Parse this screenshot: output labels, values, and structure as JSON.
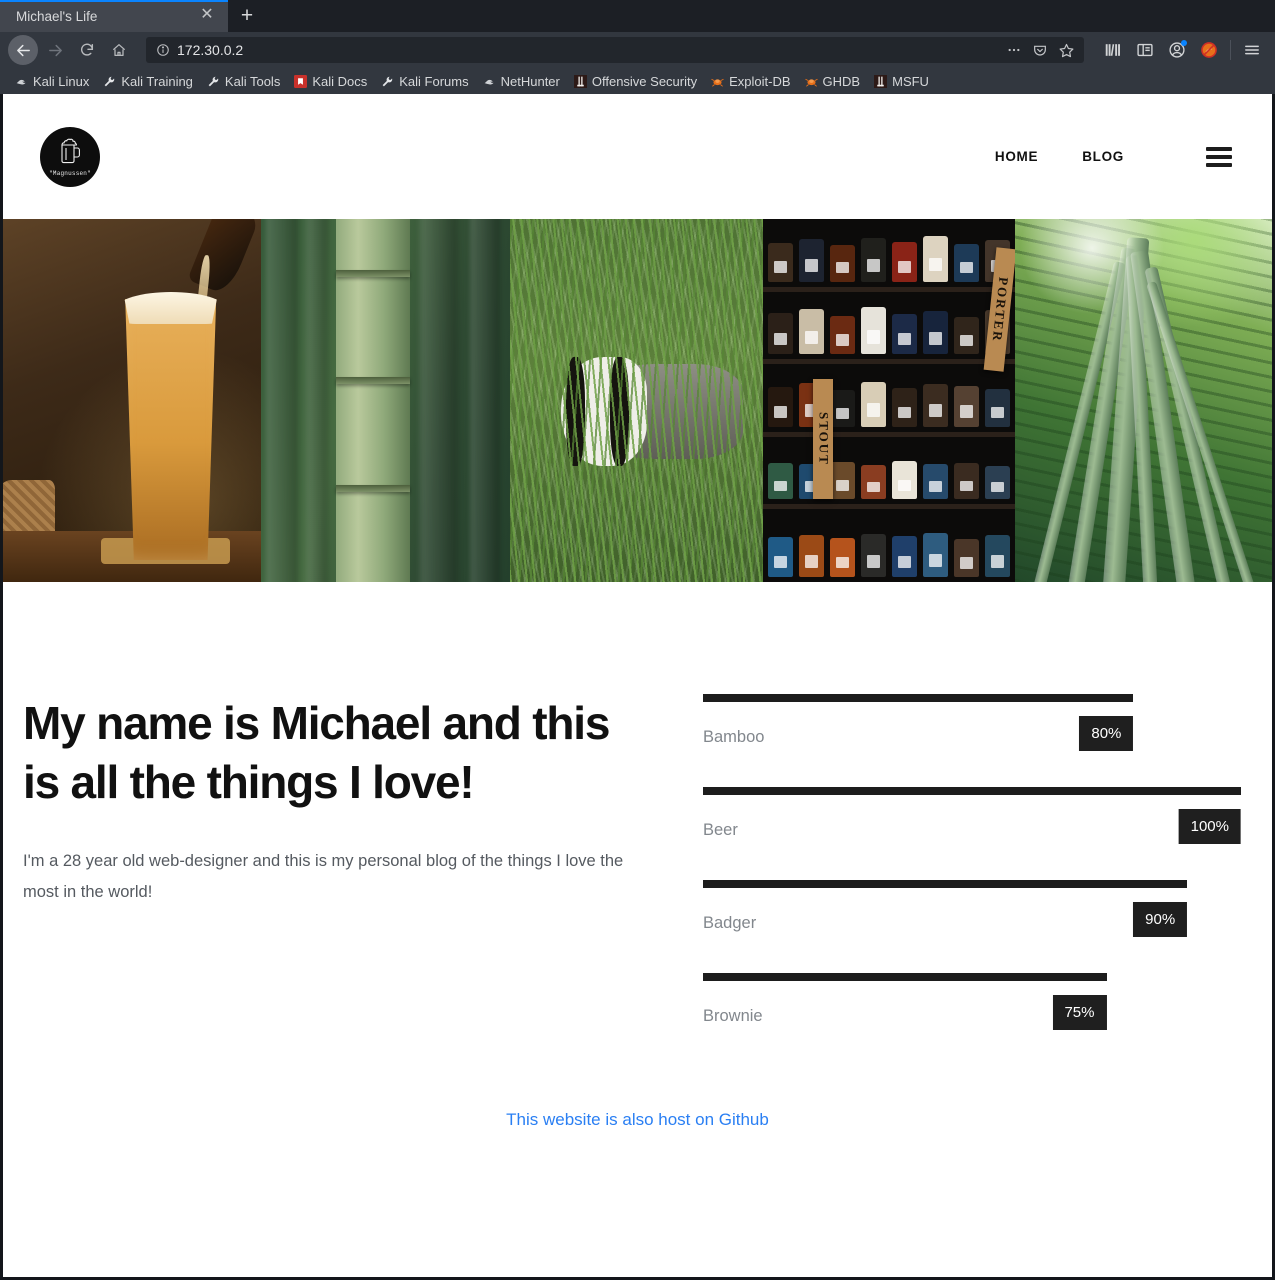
{
  "browser": {
    "tab": {
      "title": "Michael's Life",
      "close_label": "✕"
    },
    "new_tab_label": "+",
    "url": "172.30.0.2",
    "nav": {
      "back": "back-arrow",
      "forward": "forward-arrow",
      "reload": "reload-icon",
      "home": "home-icon"
    },
    "url_actions": [
      "page-actions-icon",
      "pocket-icon",
      "bookmark-star-icon"
    ],
    "toolbar_right": [
      "library-icon",
      "sidebar-icon",
      "account-icon",
      "noscript-icon",
      "menu-icon"
    ],
    "bookmarks": [
      {
        "label": "Kali Linux",
        "icon": "kali-dragon"
      },
      {
        "label": "Kali Training",
        "icon": "kali-wrench"
      },
      {
        "label": "Kali Tools",
        "icon": "kali-wrench"
      },
      {
        "label": "Kali Docs",
        "icon": "kali-docs"
      },
      {
        "label": "Kali Forums",
        "icon": "kali-wrench"
      },
      {
        "label": "NetHunter",
        "icon": "kali-dragon"
      },
      {
        "label": "Offensive Security",
        "icon": "offsec"
      },
      {
        "label": "Exploit-DB",
        "icon": "exploitdb"
      },
      {
        "label": "GHDB",
        "icon": "exploitdb"
      },
      {
        "label": "MSFU",
        "icon": "offsec"
      }
    ]
  },
  "site": {
    "logo": {
      "name": "\"Magnussen\"",
      "icon": "beer-mug-icon"
    },
    "nav": [
      {
        "label": "HOME"
      },
      {
        "label": "BLOG"
      }
    ],
    "menu_icon": "hamburger-icon",
    "gallery": [
      {
        "alt": "beer-pour"
      },
      {
        "alt": "bamboo-stalks"
      },
      {
        "alt": "badger-in-grass"
      },
      {
        "alt": "beer-bottle-shelf"
      },
      {
        "alt": "bamboo-forest"
      }
    ],
    "headline": "My name is Michael and this is all the things I love!",
    "lede": "I'm a 28 year old web-designer and this is my personal blog of the things I love the most in the world!",
    "skills": [
      {
        "label": "Bamboo",
        "percent": "80%",
        "value": 80
      },
      {
        "label": "Beer",
        "percent": "100%",
        "value": 100
      },
      {
        "label": "Badger",
        "percent": "90%",
        "value": 90
      },
      {
        "label": "Brownie",
        "percent": "75%",
        "value": 75
      }
    ],
    "footer_link": "This website is also host on Github",
    "colors": {
      "accent": "#2a7ff3",
      "bar": "#1d1d1d",
      "badge": "#1f1f1f"
    }
  },
  "shelf_signs": [
    "STOUT",
    "PORTER"
  ]
}
